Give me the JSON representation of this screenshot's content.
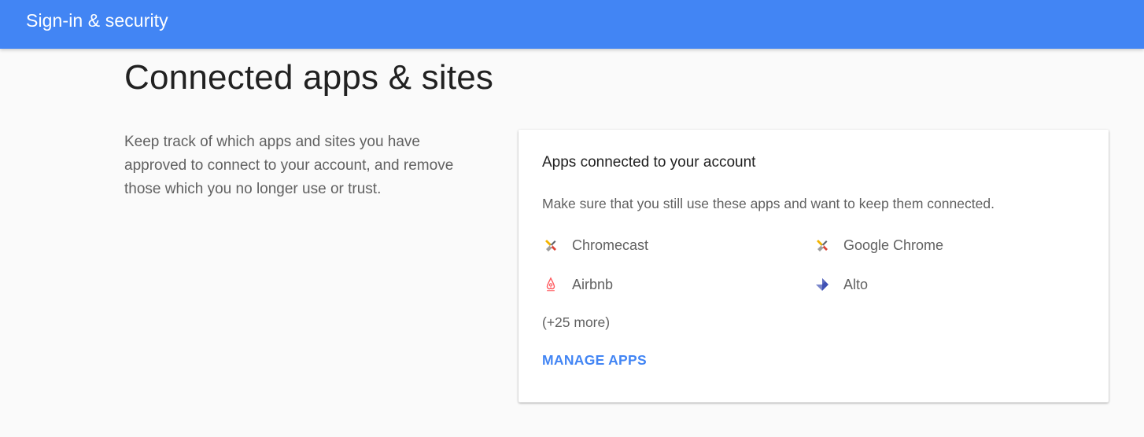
{
  "header": {
    "title": "Sign-in & security",
    "background_color": "#4285f4"
  },
  "main": {
    "title": "Connected apps & sites",
    "description": "Keep track of which apps and sites you have approved to connect to your account, and remove those which you no longer use or trust."
  },
  "card": {
    "title": "Apps connected to your account",
    "subtitle": "Make sure that you still use these apps and want to keep them connected.",
    "apps": [
      {
        "name": "Chromecast",
        "icon": "chromecast-icon"
      },
      {
        "name": "Google Chrome",
        "icon": "google-chrome-icon"
      },
      {
        "name": "Airbnb",
        "icon": "airbnb-icon"
      },
      {
        "name": "Alto",
        "icon": "alto-icon"
      }
    ],
    "more_count": "(+25 more)",
    "manage_label": "MANAGE APPS",
    "accent_color": "#4285f4"
  }
}
